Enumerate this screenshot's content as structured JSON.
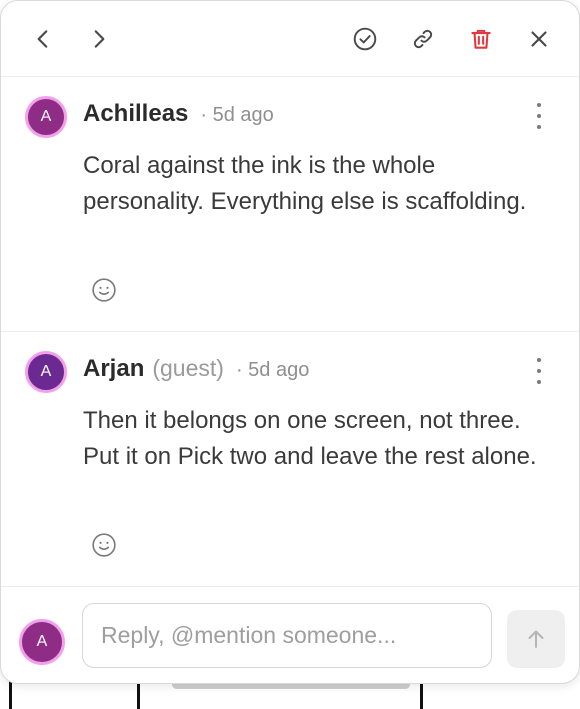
{
  "toolbar": {
    "icons": [
      "chevron-left-icon",
      "chevron-right-icon",
      "check-circle-icon",
      "link-icon",
      "trash-icon",
      "close-icon"
    ],
    "delete_color": "#e0383e"
  },
  "comments": [
    {
      "avatar_initial": "A",
      "author": "Achilleas",
      "tag": "",
      "time": "· 5d ago",
      "text": "Coral against the ink is the whole personality. Everything else is scaffolding."
    },
    {
      "avatar_initial": "A",
      "author": "Arjan",
      "tag": "(guest)",
      "time": "· 5d ago",
      "text": "Then it belongs on one screen, not three. Put it on Pick two and leave the rest alone."
    }
  ],
  "reply": {
    "avatar_initial": "A",
    "placeholder": "Reply, @mention someone...",
    "value": ""
  },
  "colors": {
    "avatar_fill": "#8e2c86",
    "avatar_ring": "#f3a0ea",
    "accent_delete": "#e0383e"
  }
}
